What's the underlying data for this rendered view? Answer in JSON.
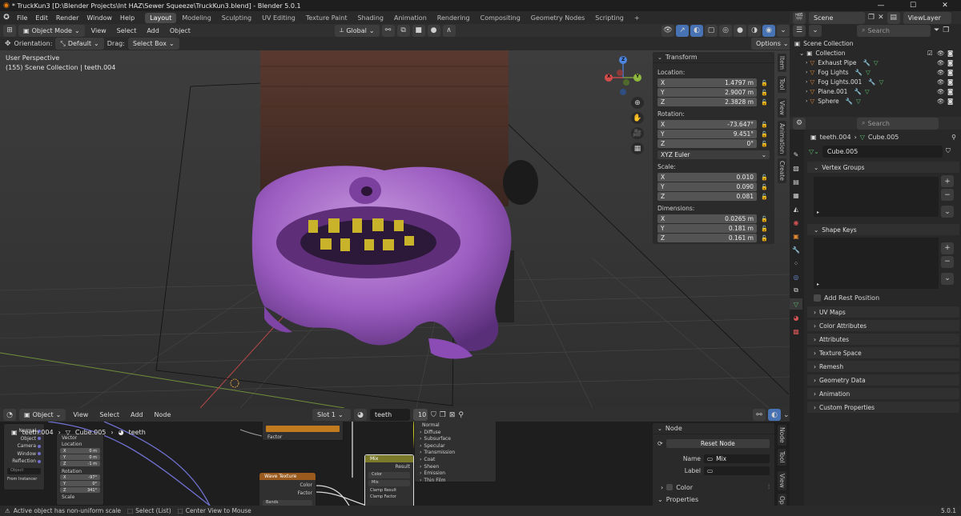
{
  "window": {
    "title": "* TruckKun3 [D:\\Blender Projects\\Int HAZ\\Sewer Squeeze\\TruckKun3.blend] - Blender 5.0.1",
    "min": "—",
    "max": "☐",
    "close": "✕"
  },
  "menus": [
    "File",
    "Edit",
    "Render",
    "Window",
    "Help"
  ],
  "workspaces": [
    "Layout",
    "Modeling",
    "Sculpting",
    "UV Editing",
    "Texture Paint",
    "Shading",
    "Animation",
    "Rendering",
    "Compositing",
    "Geometry Nodes",
    "Scripting"
  ],
  "workspace_add": "+",
  "scene": {
    "label": "Scene",
    "viewlayer": "ViewLayer"
  },
  "viewport": {
    "mode": "Object Mode",
    "menus": [
      "View",
      "Select",
      "Add",
      "Object"
    ],
    "transform": "Global",
    "orientation_label": "Orientation:",
    "orientation": "Default",
    "drag_label": "Drag:",
    "drag": "Select Box",
    "options": "Options",
    "perspective": "User Perspective",
    "collection": "(155) Scene Collection | teeth.004",
    "gizmo": {
      "x": "X",
      "y": "Y",
      "z": "Z"
    }
  },
  "npanel": {
    "header": "Transform",
    "location_label": "Location:",
    "location": [
      {
        "a": "X",
        "v": "1.4797 m"
      },
      {
        "a": "Y",
        "v": "2.9007 m"
      },
      {
        "a": "Z",
        "v": "2.3828 m"
      }
    ],
    "rotation_label": "Rotation:",
    "rotation": [
      {
        "a": "X",
        "v": "-73.647°"
      },
      {
        "a": "Y",
        "v": "9.451°"
      },
      {
        "a": "Z",
        "v": "0°"
      }
    ],
    "rotation_mode": "XYZ Euler",
    "scale_label": "Scale:",
    "scale": [
      {
        "a": "X",
        "v": "0.010"
      },
      {
        "a": "Y",
        "v": "0.090"
      },
      {
        "a": "Z",
        "v": "0.081"
      }
    ],
    "dimensions_label": "Dimensions:",
    "dimensions": [
      {
        "a": "X",
        "v": "0.0265 m"
      },
      {
        "a": "Y",
        "v": "0.181 m"
      },
      {
        "a": "Z",
        "v": "0.161 m"
      }
    ],
    "tabs": [
      "Item",
      "Tool",
      "View",
      "Animation",
      "Create"
    ]
  },
  "outliner": {
    "search_placeholder": "Search",
    "root": "Scene Collection",
    "collection": "Collection",
    "items": [
      {
        "name": "Exhaust Pipe"
      },
      {
        "name": "Fog Lights"
      },
      {
        "name": "Fog Lights.001"
      },
      {
        "name": "Plane.001"
      },
      {
        "name": "Sphere"
      }
    ]
  },
  "properties": {
    "search_placeholder": "Search",
    "object": "teeth.004",
    "mesh": "Cube.005",
    "datablock": "Cube.005",
    "vertex_groups": "Vertex Groups",
    "shape_keys": "Shape Keys",
    "add_rest_position": "Add Rest Position",
    "sections": [
      "UV Maps",
      "Color Attributes",
      "Attributes",
      "Texture Space",
      "Remesh",
      "Geometry Data",
      "Animation",
      "Custom Properties"
    ]
  },
  "node_editor": {
    "editor_type": "Object",
    "menus": [
      "View",
      "Select",
      "Add",
      "Node"
    ],
    "slot": "Slot 1",
    "material": "teeth",
    "users": "10",
    "breadcrumb": {
      "object": "teeth.004",
      "mesh": "Cube.005",
      "material": "teeth"
    },
    "side": {
      "header": "Node",
      "reset": "Reset Node",
      "name_label": "Name",
      "name": "Mix",
      "label_label": "Label",
      "color": "Color",
      "properties": "Properties",
      "tabs": [
        "Node",
        "Tool",
        "View",
        "Op"
      ]
    },
    "texcoord": {
      "outputs": [
        "Normal",
        "Object",
        "Camera",
        "Window",
        "Reflection"
      ],
      "object_field": "Object",
      "from_instancer": "From Instancer"
    },
    "mapping": {
      "vector": "Vector",
      "location": "Location",
      "loc": [
        {
          "a": "X",
          "v": "0 m"
        },
        {
          "a": "Y",
          "v": "0 m"
        },
        {
          "a": "Z",
          "v": "-1 m"
        }
      ],
      "rotation": "Rotation",
      "rot": [
        {
          "a": "X",
          "v": "-97°"
        },
        {
          "a": "Y",
          "v": "0°"
        },
        {
          "a": "Z",
          "v": "341°"
        }
      ],
      "scale": "Scale"
    },
    "colorramp": {
      "factor": "Factor"
    },
    "wave": {
      "title": "Wave Texture",
      "color": "Color",
      "factor": "Factor",
      "type": "Bands"
    },
    "mix": {
      "title": "Mix",
      "result": "Result",
      "type": "Color",
      "blend": "Mix",
      "clamp_result": "Clamp Result",
      "clamp_factor": "Clamp Factor"
    },
    "bsdf": {
      "inputs": [
        "Normal",
        "Diffuse",
        "Subsurface",
        "Specular",
        "Transmission",
        "Coat",
        "Sheen",
        "Emission",
        "Thin Film"
      ]
    }
  },
  "status": {
    "message": "Active object has non-uniform scale",
    "select": "Select (List)",
    "center": "Center View to Mouse",
    "version": "5.0.1"
  },
  "colors": {
    "accent": "#4772b3",
    "node_orange": "#c27a1e",
    "node_green": "#8b8b2b",
    "mesh_green": "#5bbd6b",
    "object_orange": "#e08833"
  }
}
